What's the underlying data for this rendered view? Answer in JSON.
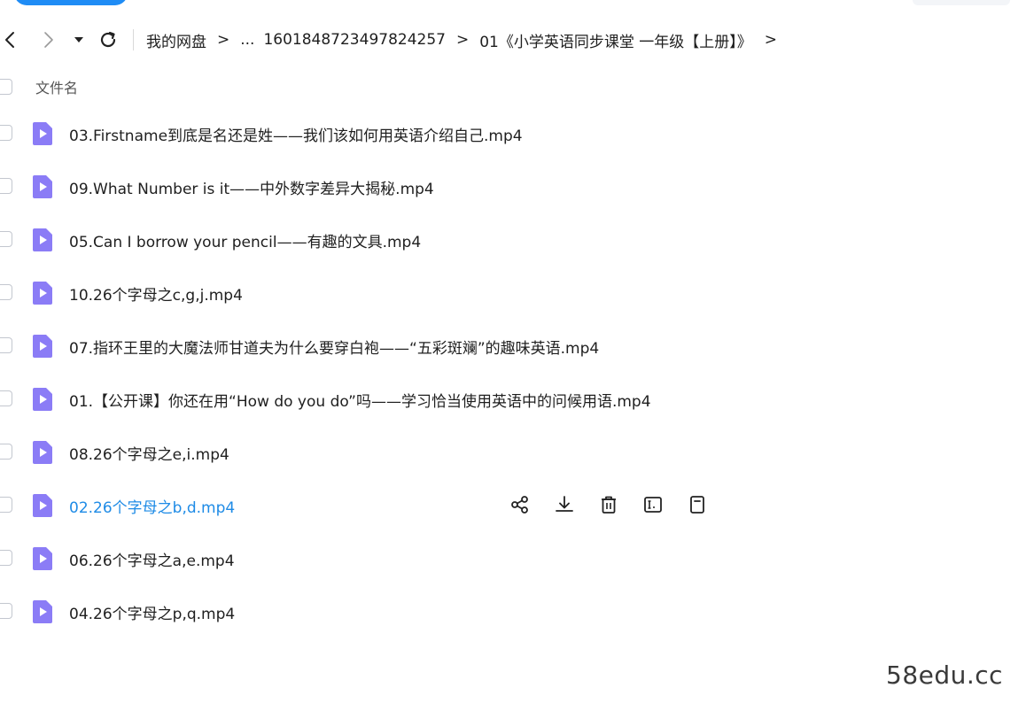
{
  "breadcrumb": {
    "root": "我的网盘",
    "sep": ">",
    "ellipsis": "...",
    "folder": "1601848723497824257",
    "current": "01《小学英语同步课堂 一年级【上册】》"
  },
  "list": {
    "column_title": "文件名",
    "files": [
      {
        "name": "03.Firstname到底是名还是姓——我们该如何用英语介绍自己.mp4"
      },
      {
        "name": "09.What Number is it——中外数字差异大揭秘.mp4"
      },
      {
        "name": "05.Can I borrow your pencil——有趣的文具.mp4"
      },
      {
        "name": "10.26个字母之c,g,j.mp4"
      },
      {
        "name": "07.指环王里的大魔法师甘道夫为什么要穿白袍——“五彩斑斓”的趣味英语.mp4"
      },
      {
        "name": "01.【公开课】你还在用“How do you do”吗——学习恰当使用英语中的问候用语.mp4"
      },
      {
        "name": "08.26个字母之e,i.mp4"
      },
      {
        "name": "02.26个字母之b,d.mp4"
      },
      {
        "name": "06.26个字母之a,e.mp4"
      },
      {
        "name": "04.26个字母之p,q.mp4"
      }
    ]
  },
  "icons": {
    "back": "chevron-left-icon",
    "forward": "chevron-right-icon",
    "dropdown": "caret-down-icon",
    "refresh": "refresh-icon",
    "file": "video-file-icon",
    "share": "share-icon",
    "download": "download-icon",
    "delete": "trash-icon",
    "rename": "rename-icon",
    "more": "document-icon"
  },
  "colors": {
    "accent": "#1e8be6",
    "file_icon": "#8b7cf6",
    "text": "#1f1f1f"
  },
  "watermark": "58edu.cc"
}
